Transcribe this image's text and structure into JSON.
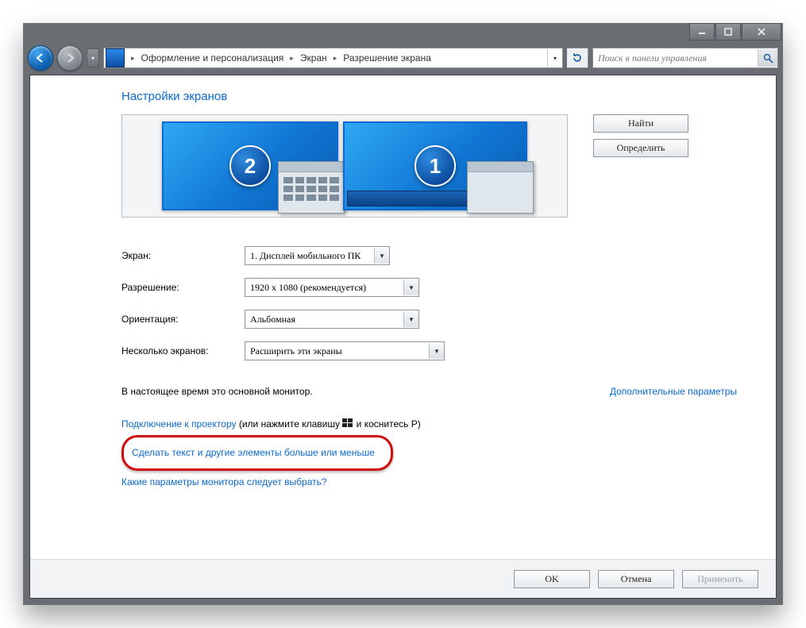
{
  "titlebar": {},
  "breadcrumb": {
    "item1": "Оформление и персонализация",
    "item2": "Экран",
    "item3": "Разрешение экрана"
  },
  "search": {
    "placeholder": "Поиск в панели управления"
  },
  "page": {
    "heading": "Настройки экранов",
    "find_btn": "Найти",
    "identify_btn": "Определить",
    "monitor1_num": "1",
    "monitor2_num": "2",
    "label_display": "Экран:",
    "label_resolution": "Разрешение:",
    "label_orientation": "Ориентация:",
    "label_multi": "Несколько экранов:",
    "sel_display": "1. Дисплей мобильного ПК",
    "sel_resolution": "1920 x 1080 (рекомендуется)",
    "sel_orientation": "Альбомная",
    "sel_multi": "Расширить эти экраны",
    "main_note": "В настоящее время это основной монитор.",
    "adv_link": "Дополнительные параметры",
    "projector_link": "Подключение к проектору",
    "projector_rest": " (или нажмите клавишу ",
    "projector_tail": " и коснитесь P)",
    "bigger_link": "Сделать текст и другие элементы больше или меньше",
    "which_link": "Какие параметры монитора следует выбрать?",
    "ok": "OK",
    "cancel": "Отмена",
    "apply": "Применить"
  }
}
